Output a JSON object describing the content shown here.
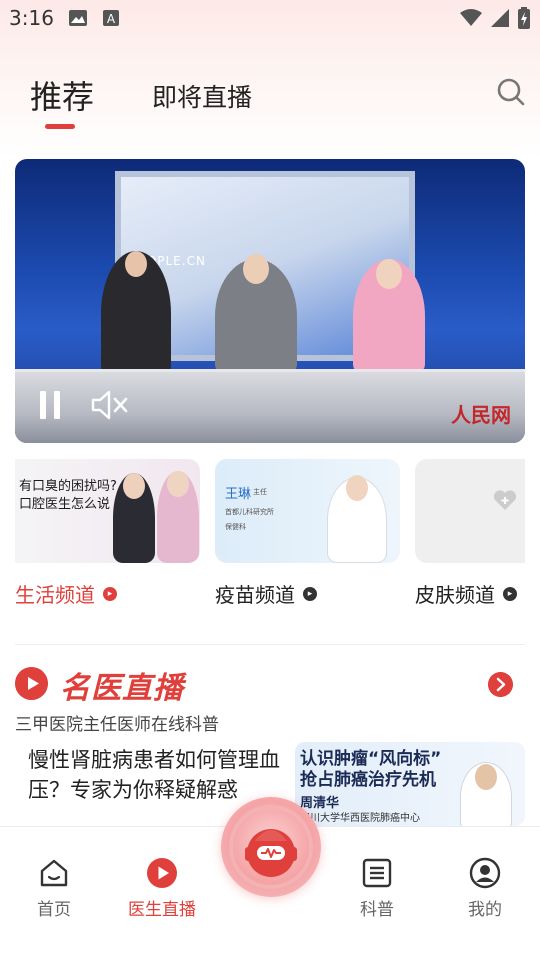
{
  "status_bar": {
    "time": "3:16",
    "icons": [
      "image-icon",
      "font-icon",
      "wifi-icon",
      "signal-icon",
      "battery-icon"
    ]
  },
  "tabs": [
    {
      "label": "推荐",
      "active": true
    },
    {
      "label": "即将直播",
      "active": false
    }
  ],
  "video": {
    "screen_text": "PEOPLE.CN",
    "logo_text": "人民网",
    "controls": [
      "pause-icon",
      "mute-icon"
    ]
  },
  "channels": [
    {
      "label": "生活频道",
      "color": "#e0403b",
      "card_lines": [
        "有口臭的困扰吗?",
        "口腔医生怎么说"
      ]
    },
    {
      "label": "疫苗频道",
      "color": "#222222",
      "card_name": "王琳",
      "card_title": "主任",
      "card_org": "首都儿科研究所",
      "card_dept": "保健科"
    },
    {
      "label": "皮肤频道",
      "color": "#222222"
    }
  ],
  "live_section": {
    "title": "名医直播",
    "subtitle": "三甲医院主任医师在线科普",
    "items": [
      {
        "title": "慢性肾脏病患者如何管理血压？专家为你释疑解惑"
      },
      {
        "title_line1": "认识肿瘤“风向标”",
        "title_line2": "抢占肺癌治疗先机",
        "doctor_name": "周清华",
        "hospital": "四川大学华西医院肺癌中心"
      }
    ]
  },
  "bottom_nav": [
    {
      "label": "首页",
      "icon": "home-icon",
      "active": false
    },
    {
      "label": "医生直播",
      "icon": "play-circle-icon",
      "active": true
    },
    {
      "label": "科普",
      "icon": "list-icon",
      "active": false
    },
    {
      "label": "我的",
      "icon": "user-icon",
      "active": false
    }
  ],
  "colors": {
    "accent": "#e0403b",
    "text": "#222222",
    "secondary_text": "#666666"
  }
}
